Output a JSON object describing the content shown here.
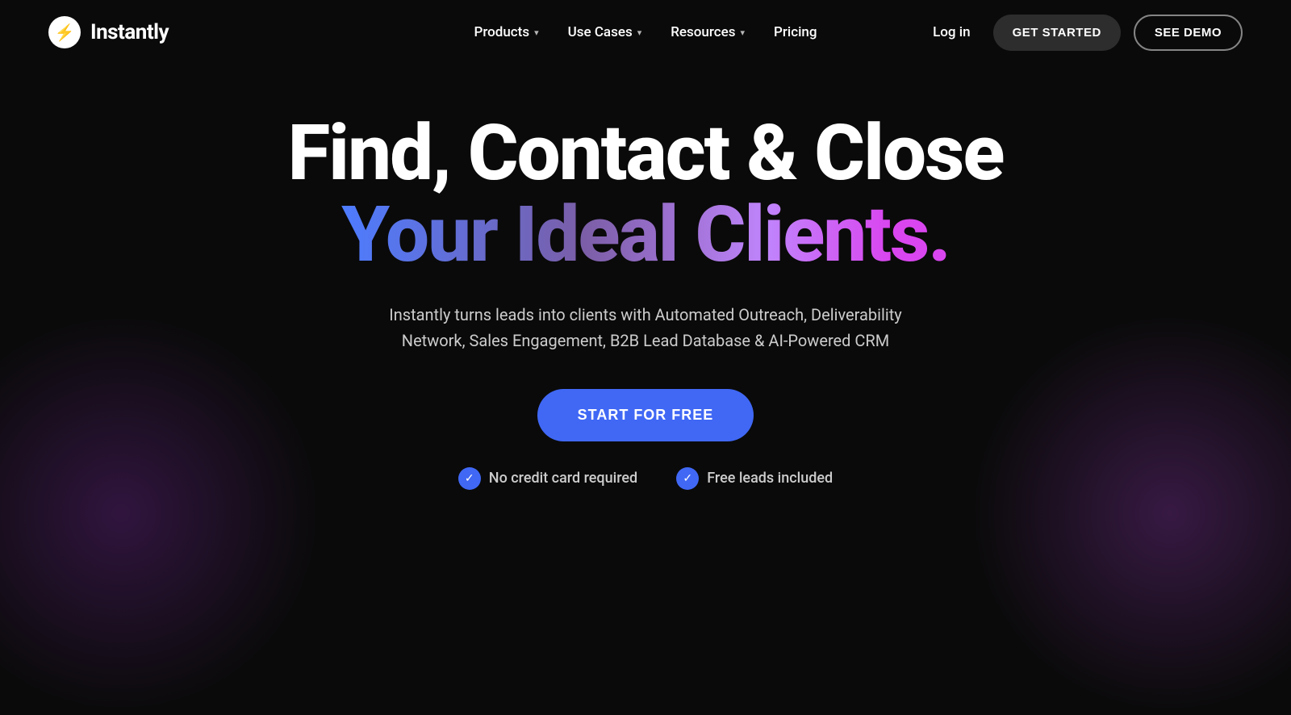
{
  "brand": {
    "logo_symbol": "⚡",
    "logo_text": "Instantly"
  },
  "nav": {
    "links": [
      {
        "label": "Products",
        "has_dropdown": true
      },
      {
        "label": "Use Cases",
        "has_dropdown": true
      },
      {
        "label": "Resources",
        "has_dropdown": true
      },
      {
        "label": "Pricing",
        "has_dropdown": false
      }
    ],
    "login_label": "Log in",
    "get_started_label": "GET STARTED",
    "see_demo_label": "SEE DEMO"
  },
  "hero": {
    "title_line1": "Find, Contact & Close",
    "title_line2": "Your Ideal Clients.",
    "subtitle": "Instantly turns leads into clients with Automated Outreach, Deliverability Network, Sales Engagement, B2B Lead Database & AI-Powered CRM",
    "cta_label": "START FOR FREE",
    "badges": [
      {
        "label": "No credit card required"
      },
      {
        "label": "Free leads included"
      }
    ]
  }
}
